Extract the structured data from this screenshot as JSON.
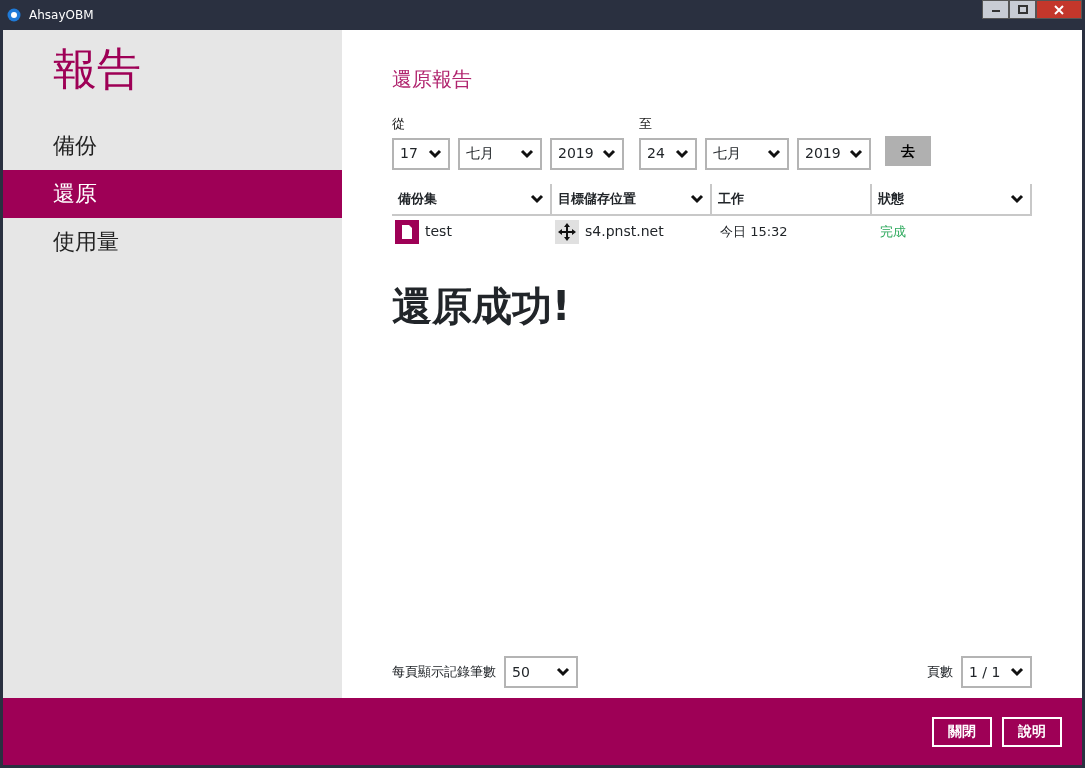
{
  "window": {
    "title": "AhsayOBM"
  },
  "sidebar": {
    "title": "報告",
    "items": [
      {
        "label": "備份",
        "selected": false
      },
      {
        "label": "還原",
        "selected": true
      },
      {
        "label": "使用量",
        "selected": false
      }
    ]
  },
  "main": {
    "heading": "還原報告",
    "from": {
      "label": "從",
      "day": "17",
      "month": "七月",
      "year": "2019"
    },
    "to": {
      "label": "至",
      "day": "24",
      "month": "七月",
      "year": "2019"
    },
    "go_button": "去",
    "table": {
      "columns": [
        {
          "label": "備份集",
          "dropdown": true
        },
        {
          "label": "目標儲存位置",
          "dropdown": true
        },
        {
          "label": "工作",
          "dropdown": false
        },
        {
          "label": "狀態",
          "dropdown": true
        }
      ],
      "rows": [
        {
          "backup_set": "test",
          "destination": "s4.pnst.net",
          "job": "今日 15:32",
          "status": "完成"
        }
      ]
    },
    "message": "還原成功!",
    "per_page": {
      "label": "每頁顯示記錄筆數",
      "value": "50"
    },
    "page": {
      "label": "頁數",
      "value": "1 / 1"
    }
  },
  "footer": {
    "buttons": [
      "關閉",
      "說明"
    ]
  }
}
